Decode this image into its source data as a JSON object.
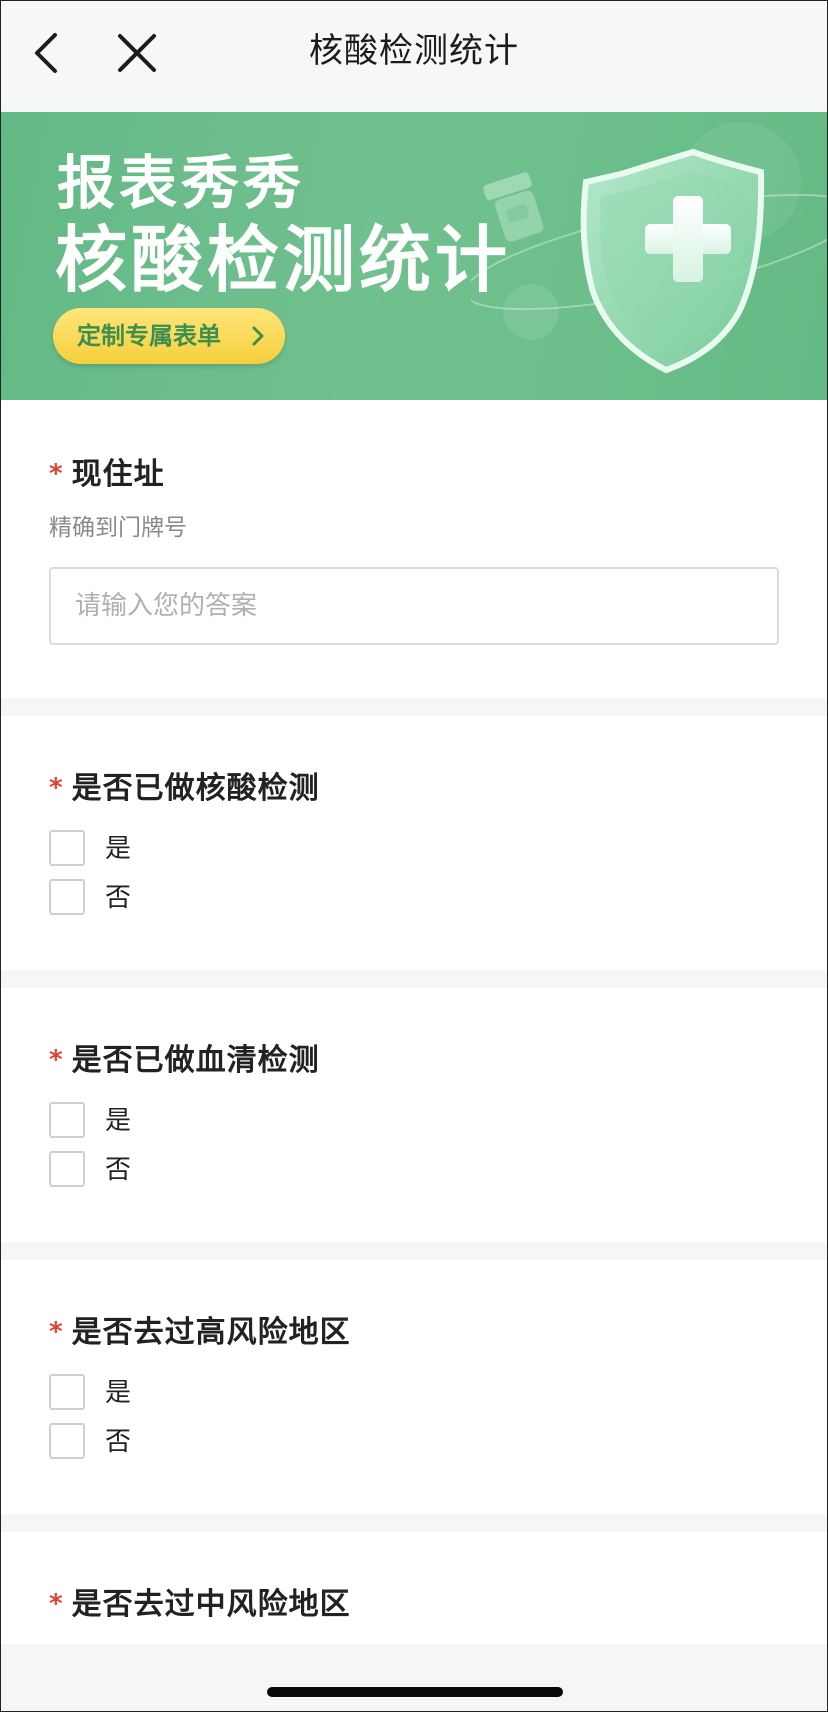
{
  "nav": {
    "title": "核酸检测统计"
  },
  "banner": {
    "line1": "报表秀秀",
    "line2": "核酸检测统计",
    "cta_label": "定制专属表单",
    "colors": {
      "background": "#6cbf8a",
      "cta": "#f6cf3c",
      "cta_text": "#3d8f4f"
    }
  },
  "form": {
    "address": {
      "required_mark": "*",
      "label": "现住址",
      "hint": "精确到门牌号",
      "placeholder": "请输入您的答案",
      "value": ""
    },
    "questions": [
      {
        "required_mark": "*",
        "label": "是否已做核酸检测",
        "options": [
          {
            "label": "是",
            "checked": false
          },
          {
            "label": "否",
            "checked": false
          }
        ]
      },
      {
        "required_mark": "*",
        "label": "是否已做血清检测",
        "options": [
          {
            "label": "是",
            "checked": false
          },
          {
            "label": "否",
            "checked": false
          }
        ]
      },
      {
        "required_mark": "*",
        "label": "是否去过高风险地区",
        "options": [
          {
            "label": "是",
            "checked": false
          },
          {
            "label": "否",
            "checked": false
          }
        ]
      },
      {
        "required_mark": "*",
        "label": "是否去过中风险地区",
        "options": []
      }
    ]
  },
  "colors": {
    "required_star": "#e5402e",
    "page_bg": "#f5f6f8",
    "card_bg": "#ffffff"
  }
}
